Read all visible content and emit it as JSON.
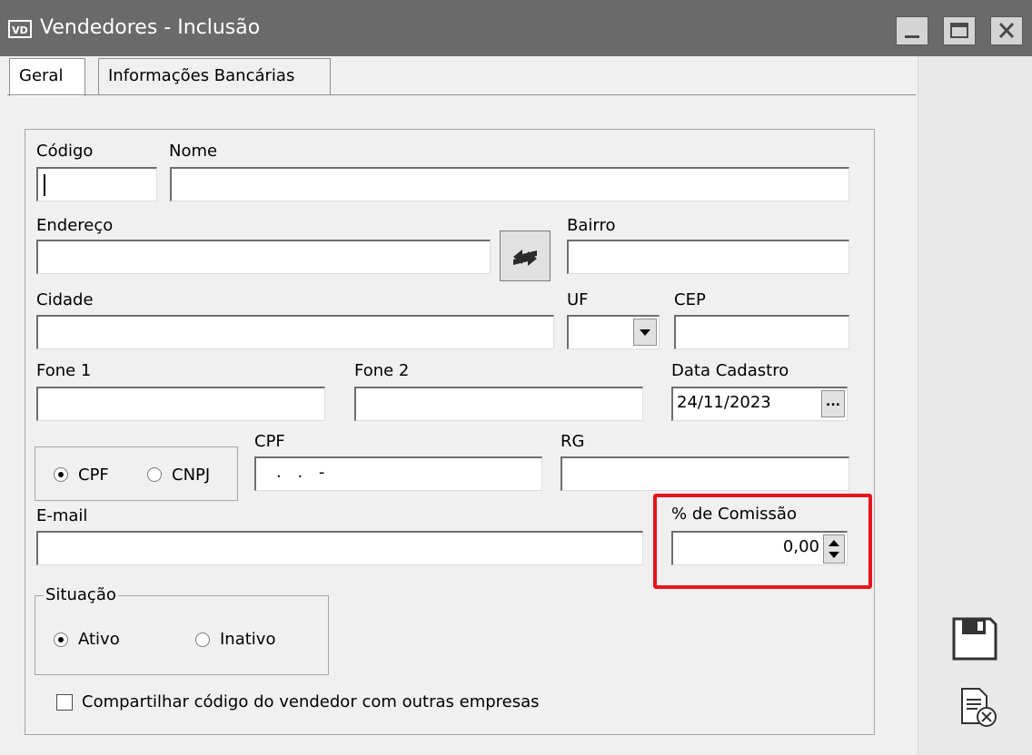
{
  "window": {
    "app_badge": "VD",
    "title": "Vendedores - Inclusão"
  },
  "tabs": [
    {
      "label": "Geral",
      "active": true
    },
    {
      "label": "Informações Bancárias",
      "active": false
    }
  ],
  "form": {
    "codigo": {
      "label": "Código",
      "value": ""
    },
    "nome": {
      "label": "Nome",
      "value": ""
    },
    "endereco": {
      "label": "Endereço",
      "value": ""
    },
    "bairro": {
      "label": "Bairro",
      "value": ""
    },
    "cidade": {
      "label": "Cidade",
      "value": ""
    },
    "uf": {
      "label": "UF",
      "value": ""
    },
    "cep": {
      "label": "CEP",
      "value": ""
    },
    "fone1": {
      "label": "Fone 1",
      "value": ""
    },
    "fone2": {
      "label": "Fone 2",
      "value": ""
    },
    "data_cadastro": {
      "label": "Data Cadastro",
      "value": "24/11/2023",
      "button": "..."
    },
    "doc_type": {
      "options": [
        "CPF",
        "CNPJ"
      ],
      "selected": "CPF"
    },
    "cpf": {
      "label": "CPF",
      "value": ". . -"
    },
    "rg": {
      "label": "RG",
      "value": ""
    },
    "email": {
      "label": "E-mail",
      "value": ""
    },
    "comissao": {
      "label": "% de Comissão",
      "value": "0,00"
    },
    "situacao": {
      "label": "Situação",
      "options": [
        "Ativo",
        "Inativo"
      ],
      "selected": "Ativo"
    },
    "compartilhar": {
      "label": "Compartilhar código do vendedor com outras empresas",
      "checked": false
    }
  },
  "colors": {
    "titlebar": "#6a6a6a",
    "highlight": "#e8141c",
    "background": "#f0f0f0"
  },
  "icons": {
    "swap": "swap-arrows-icon",
    "save": "floppy-disk-icon",
    "cancel": "document-cancel-icon"
  }
}
